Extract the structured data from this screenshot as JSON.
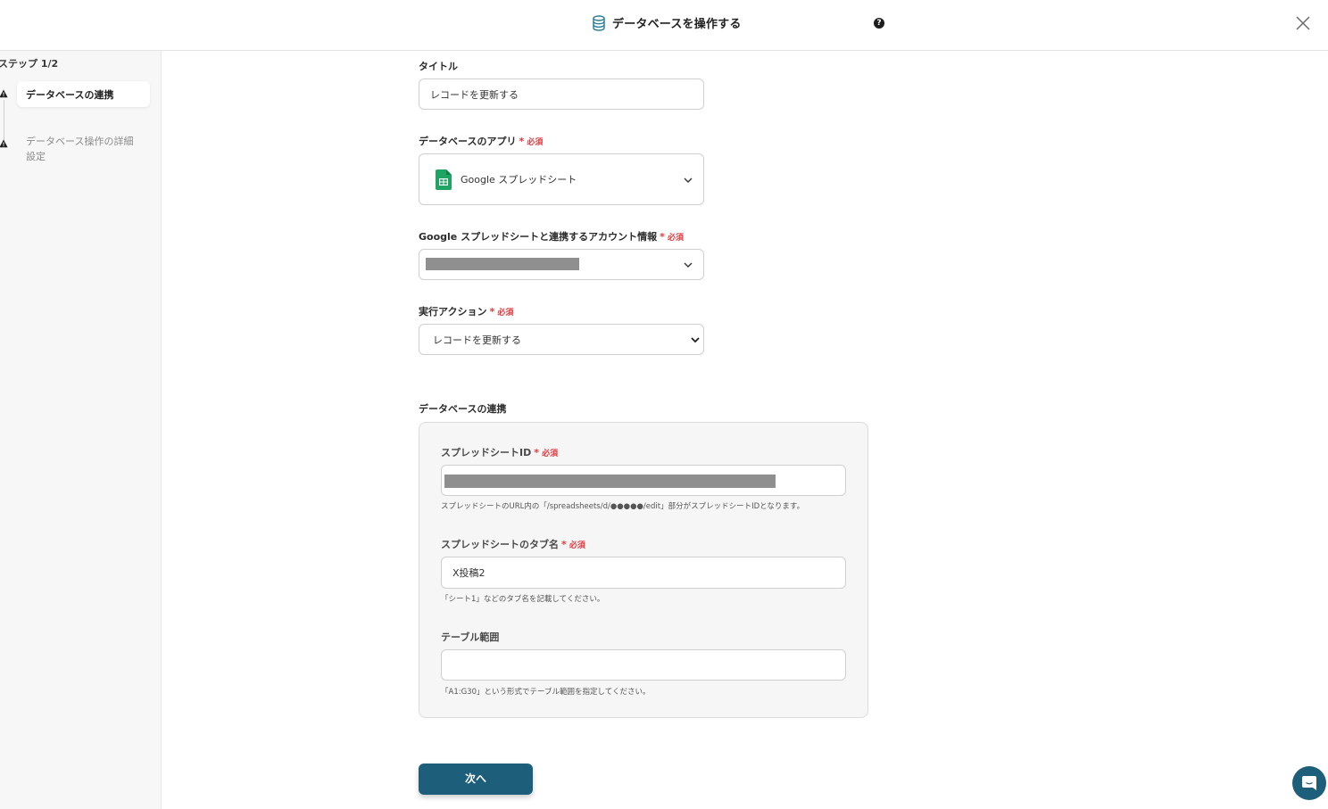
{
  "header": {
    "title": "データベースを操作する",
    "help": "?"
  },
  "sidebar": {
    "step_count": "ステップ 1/2",
    "steps": [
      {
        "label": "データベースの連携"
      },
      {
        "label": "データベース操作の詳細設定"
      }
    ]
  },
  "form": {
    "required_label": "必須",
    "title_label": "タイトル",
    "title_value": "レコードを更新する",
    "db_app_label": "データベースのアプリ",
    "db_app_value": "Google スプレッドシート",
    "account_label": "Google スプレッドシートと連携するアカウント情報",
    "action_label": "実行アクション",
    "action_value": "レコードを更新する",
    "section_title": "データベースの連携",
    "sheet_id_label": "スプレッドシートID",
    "sheet_id_hint": "スプレッドシートのURL内の「/spreadsheets/d/●●●●●/edit」部分がスプレッドシートIDとなります。",
    "tab_name_label": "スプレッドシートのタブ名",
    "tab_name_value": "X投稿2",
    "tab_name_hint": "「シート1」などのタブ名を記載してください。",
    "range_label": "テーブル範囲",
    "range_value": "",
    "range_hint": "「A1:G30」という形式でテーブル範囲を指定してください。",
    "next_button": "次へ"
  },
  "colors": {
    "primary": "#1d5f7a",
    "required": "#e0393e",
    "sheets_green": "#1fa463"
  }
}
